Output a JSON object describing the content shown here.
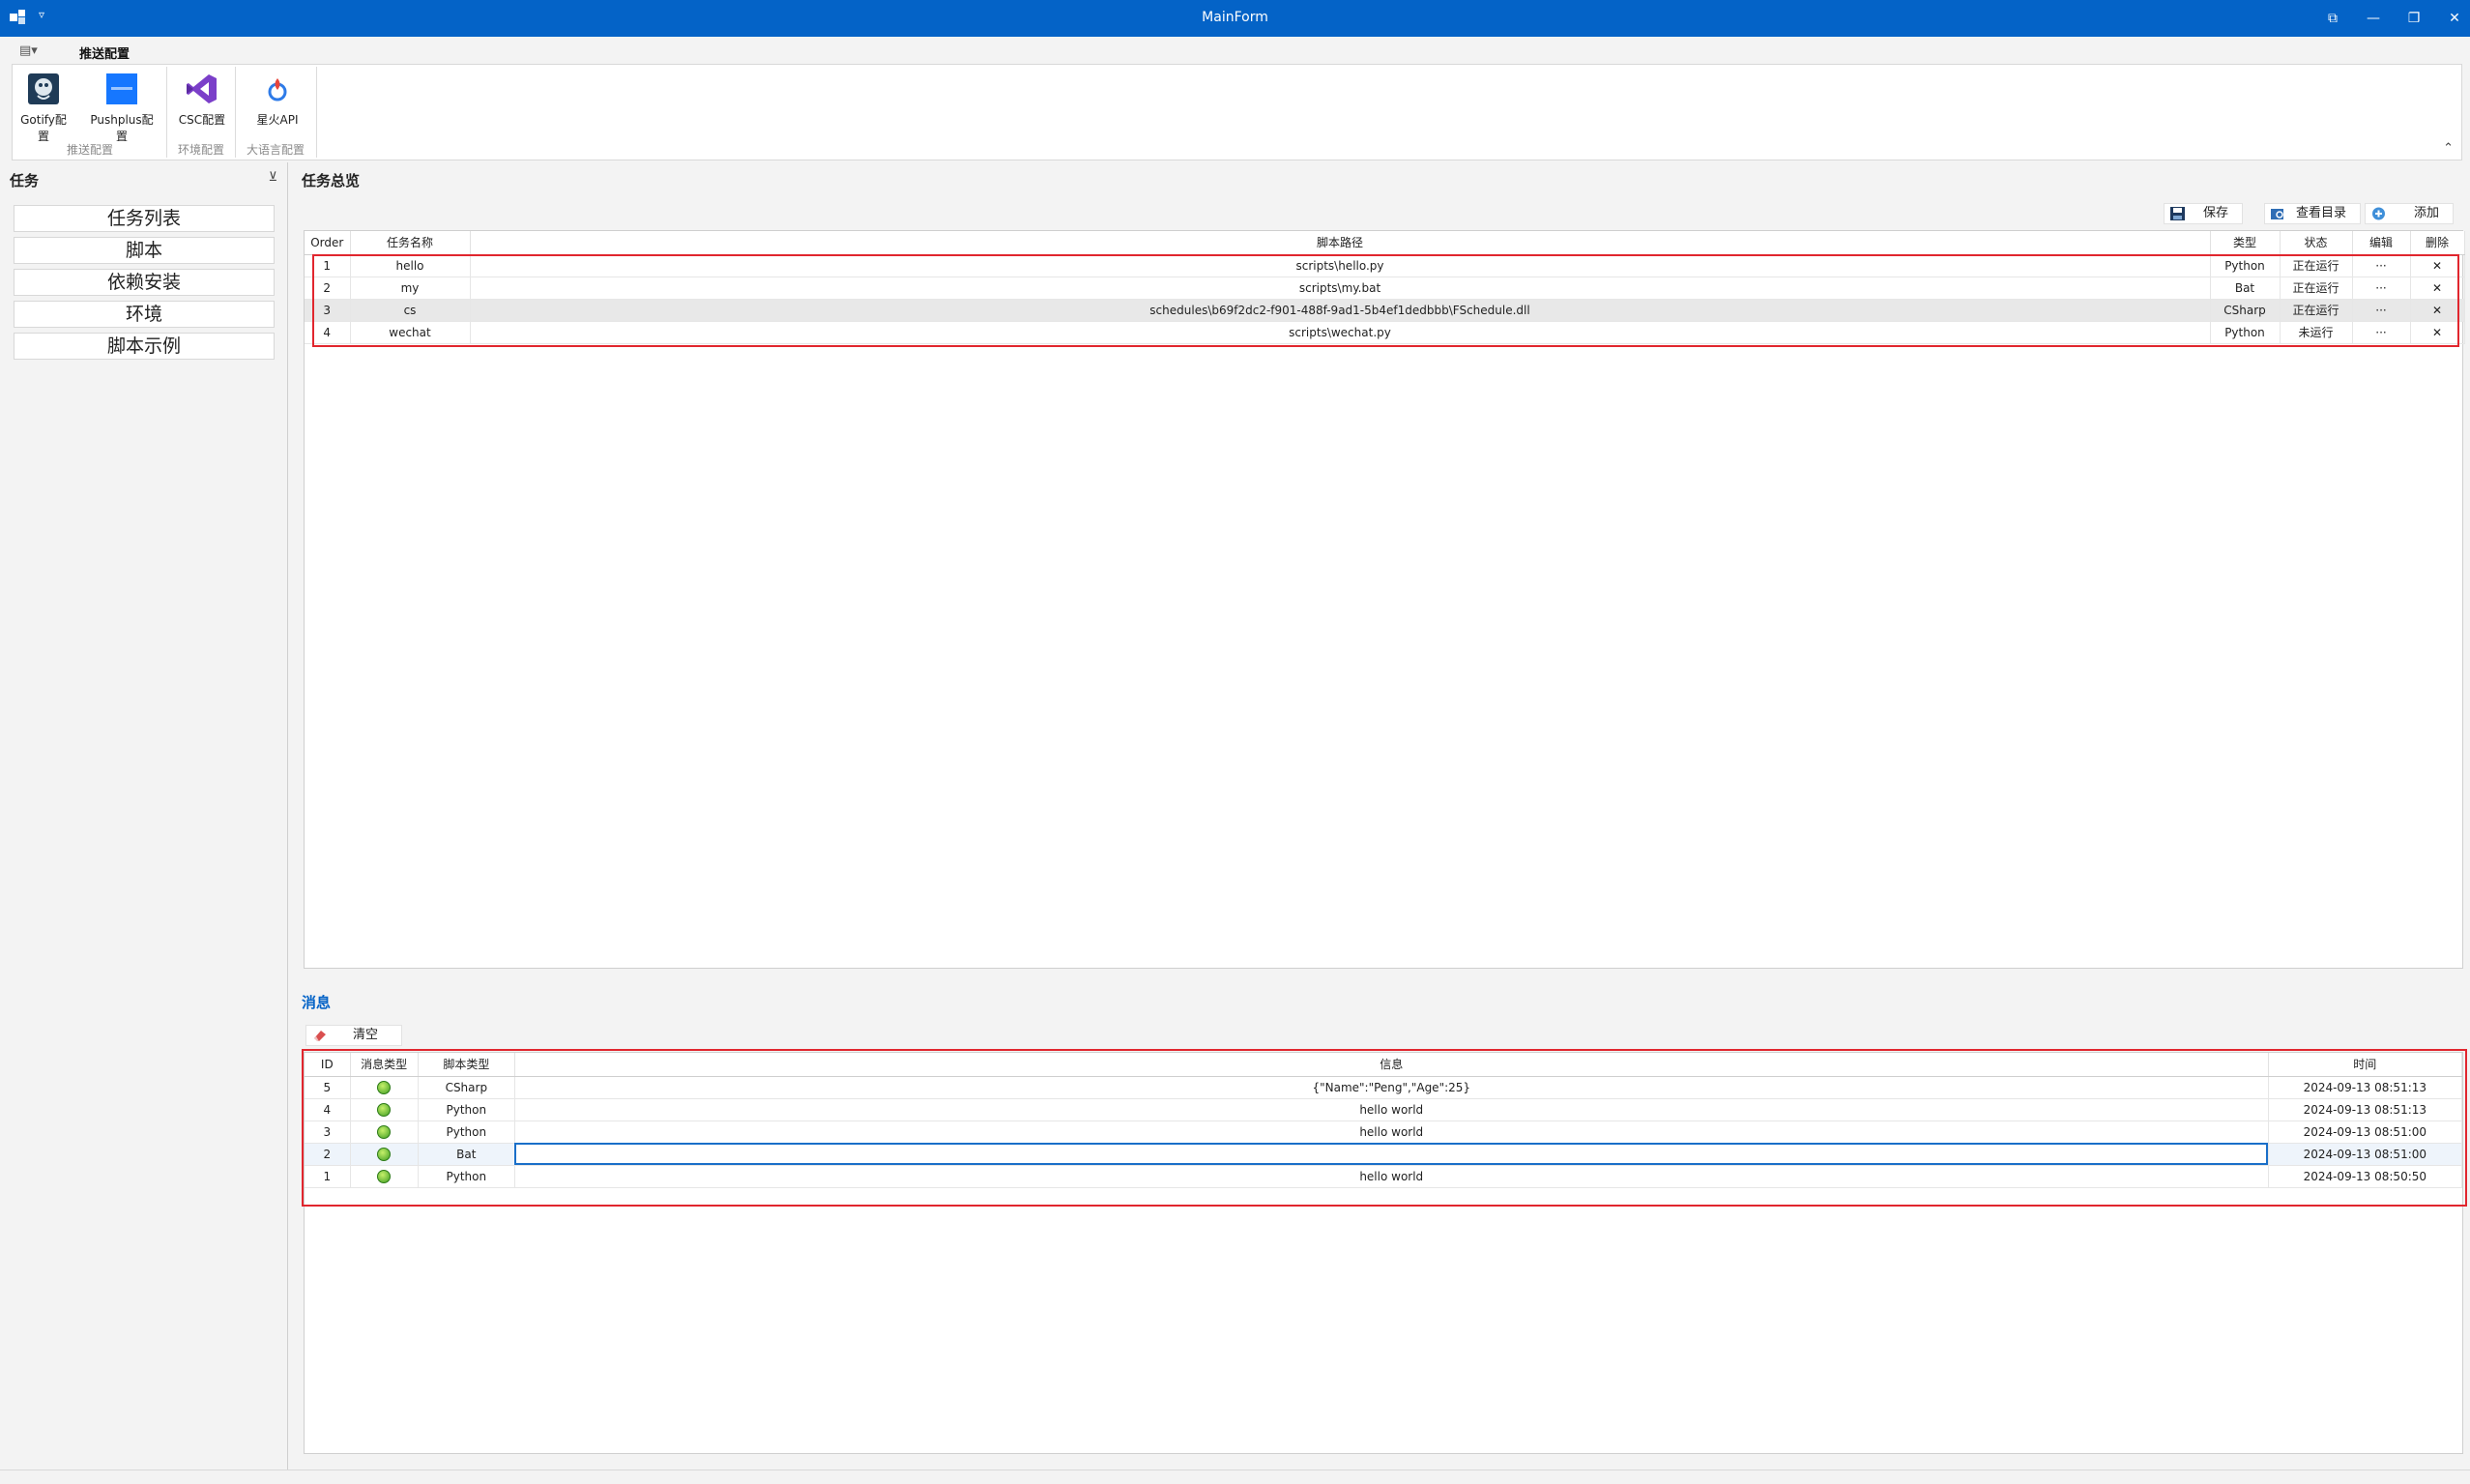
{
  "window": {
    "title": "MainForm",
    "quick_access": "▿",
    "controls": [
      "⧉",
      "—",
      "❐",
      "✕"
    ]
  },
  "ribbon": {
    "menu_icon": "▤▾",
    "tab": "推送配置",
    "buttons": [
      {
        "label": "Gotify配置",
        "icon": "gotify-icon"
      },
      {
        "label": "Pushplus配置",
        "icon": "pushplus-icon"
      },
      {
        "label": "CSC配置",
        "icon": "visual-studio-icon"
      },
      {
        "label": "星火API",
        "icon": "spark-icon"
      }
    ],
    "groups": [
      "推送配置",
      "环境配置",
      "大语言配置"
    ],
    "collapse": "⌃"
  },
  "sidebar": {
    "title": "任务",
    "pin": "⊻",
    "items": [
      "任务列表",
      "脚本",
      "依赖安装",
      "环境",
      "脚本示例"
    ]
  },
  "tasks": {
    "title": "任务总览",
    "toolbar": {
      "save": "保存",
      "view_dir": "查看目录",
      "add": "添加"
    },
    "columns": [
      "Order",
      "任务名称",
      "脚本路径",
      "类型",
      "状态",
      "编辑",
      "删除"
    ],
    "rows": [
      {
        "order": "1",
        "name": "hello",
        "path": "scripts\\hello.py",
        "type": "Python",
        "status": "正在运行",
        "edit": "···",
        "delete": "✕"
      },
      {
        "order": "2",
        "name": "my",
        "path": "scripts\\my.bat",
        "type": "Bat",
        "status": "正在运行",
        "edit": "···",
        "delete": "✕"
      },
      {
        "order": "3",
        "name": "cs",
        "path": "schedules\\b69f2dc2-f901-488f-9ad1-5b4ef1dedbbb\\FSchedule.dll",
        "type": "CSharp",
        "status": "正在运行",
        "edit": "···",
        "delete": "✕"
      },
      {
        "order": "4",
        "name": "wechat",
        "path": "scripts\\wechat.py",
        "type": "Python",
        "status": "未运行",
        "edit": "···",
        "delete": "✕"
      }
    ]
  },
  "messages": {
    "title": "消息",
    "toolbar": {
      "clear": "清空"
    },
    "columns": [
      "ID",
      "消息类型",
      "脚本类型",
      "信息",
      "时间"
    ],
    "rows": [
      {
        "id": "5",
        "script_type": "CSharp",
        "info": "{\"Name\":\"Peng\",\"Age\":25}",
        "time": "2024-09-13 08:51:13"
      },
      {
        "id": "4",
        "script_type": "Python",
        "info": "hello world",
        "time": "2024-09-13 08:51:13"
      },
      {
        "id": "3",
        "script_type": "Python",
        "info": "hello world",
        "time": "2024-09-13 08:51:00"
      },
      {
        "id": "2",
        "script_type": "Bat",
        "info": "",
        "time": "2024-09-13 08:51:00"
      },
      {
        "id": "1",
        "script_type": "Python",
        "info": "hello world",
        "time": "2024-09-13 08:50:50"
      }
    ]
  },
  "colors": {
    "accent": "#0463c7",
    "highlight_border": "#e1262e",
    "ok": "#3f9e23"
  }
}
